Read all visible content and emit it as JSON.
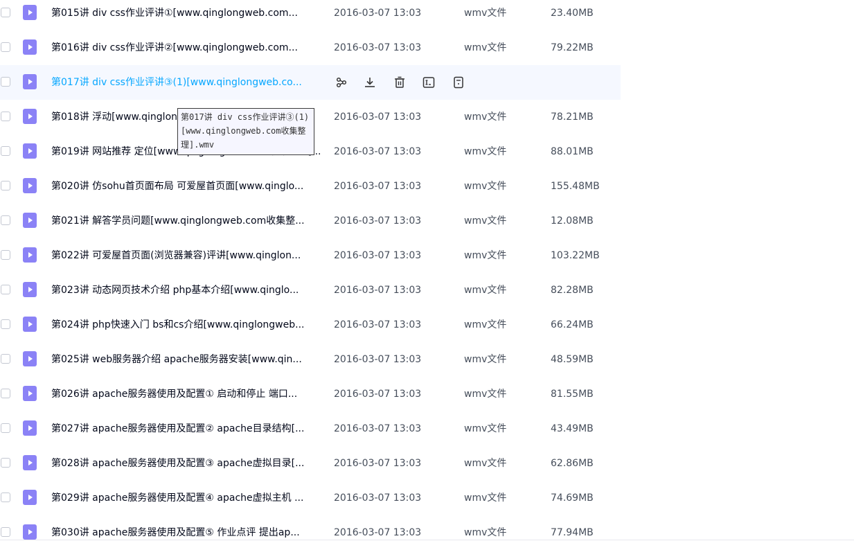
{
  "files": [
    {
      "name": "第015讲 div css作业评讲①[www.qinglongweb.com...",
      "date": "2016-03-07 13:03",
      "type": "wmv文件",
      "size": "23.40MB"
    },
    {
      "name": "第016讲 div css作业评讲②[www.qinglongweb.com...",
      "date": "2016-03-07 13:03",
      "type": "wmv文件",
      "size": "79.22MB"
    },
    {
      "name": "第017讲 div css作业评讲③(1)[www.qinglongweb.co...",
      "date": "",
      "type": "",
      "size": ""
    },
    {
      "name": "第018讲 浮动[www.qinglongweb.com收集整理].wmv",
      "date": "2016-03-07 13:03",
      "type": "wmv文件",
      "size": "78.21MB"
    },
    {
      "name": "第019讲 网站推荐 定位[www.qinglongweb.com收集整理]...",
      "date": "2016-03-07 13:03",
      "type": "wmv文件",
      "size": "88.01MB"
    },
    {
      "name": "第020讲 仿sohu首页面布局 可爱屋首页面[www.qinglo...",
      "date": "2016-03-07 13:03",
      "type": "wmv文件",
      "size": "155.48MB"
    },
    {
      "name": "第021讲 解答学员问题[www.qinglongweb.com收集整...",
      "date": "2016-03-07 13:03",
      "type": "wmv文件",
      "size": "12.08MB"
    },
    {
      "name": "第022讲 可爱屋首页面(浏览器兼容)评讲[www.qinglon...",
      "date": "2016-03-07 13:03",
      "type": "wmv文件",
      "size": "103.22MB"
    },
    {
      "name": "第023讲 动态网页技术介绍 php基本介绍[www.qinglo...",
      "date": "2016-03-07 13:03",
      "type": "wmv文件",
      "size": "82.28MB"
    },
    {
      "name": "第024讲 php快速入门 bs和cs介绍[www.qinglongweb...",
      "date": "2016-03-07 13:03",
      "type": "wmv文件",
      "size": "66.24MB"
    },
    {
      "name": "第025讲 web服务器介绍 apache服务器安装[www.qin...",
      "date": "2016-03-07 13:03",
      "type": "wmv文件",
      "size": "48.59MB"
    },
    {
      "name": "第026讲 apache服务器使用及配置① 启动和停止 端口...",
      "date": "2016-03-07 13:03",
      "type": "wmv文件",
      "size": "81.55MB"
    },
    {
      "name": "第027讲 apache服务器使用及配置② apache目录结构[...",
      "date": "2016-03-07 13:03",
      "type": "wmv文件",
      "size": "43.49MB"
    },
    {
      "name": "第028讲 apache服务器使用及配置③ apache虚拟目录[...",
      "date": "2016-03-07 13:03",
      "type": "wmv文件",
      "size": "62.86MB"
    },
    {
      "name": "第029讲 apache服务器使用及配置④ apache虚拟主机 ...",
      "date": "2016-03-07 13:03",
      "type": "wmv文件",
      "size": "74.69MB"
    },
    {
      "name": "第030讲 apache服务器使用及配置⑤ 作业点评 提出ap...",
      "date": "2016-03-07 13:03",
      "type": "wmv文件",
      "size": "77.94MB"
    }
  ],
  "hovered_index": 2,
  "row_actions": [
    {
      "name": "share-icon"
    },
    {
      "name": "download-icon"
    },
    {
      "name": "delete-icon"
    },
    {
      "name": "rename-icon"
    },
    {
      "name": "more-info-icon"
    }
  ],
  "tooltip": {
    "text": "第017讲 div css作业评讲③(1)[www.qinglongweb.com收集整理].wmv"
  },
  "colors": {
    "file_icon": "#8b82f6",
    "hover_text": "#06a7ff",
    "hover_row_bg": "#f5f8ff"
  }
}
